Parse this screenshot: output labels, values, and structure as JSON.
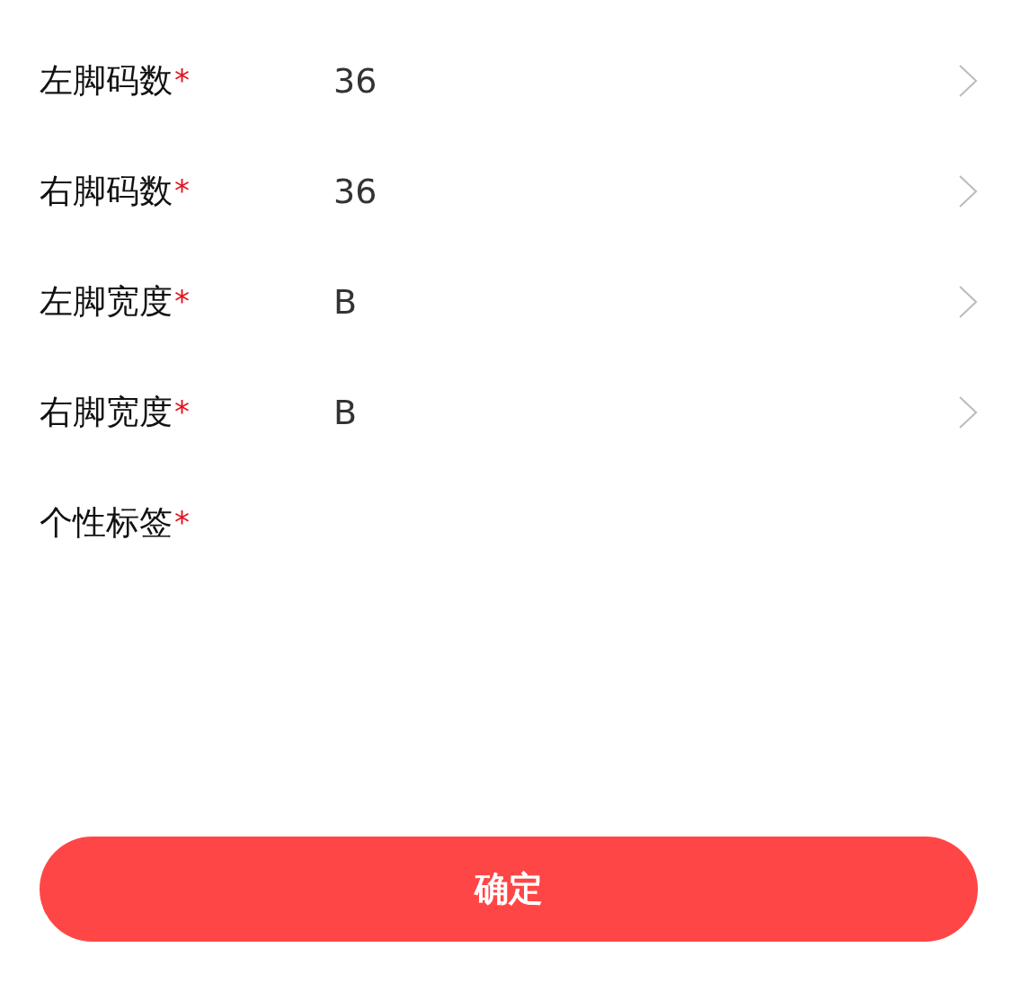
{
  "fields": [
    {
      "kind": "select",
      "label": "左脚码数",
      "required_mark": "*",
      "value": "36"
    },
    {
      "kind": "select",
      "label": "右脚码数",
      "required_mark": "*",
      "value": "36"
    },
    {
      "kind": "select",
      "label": "左脚宽度",
      "required_mark": "*",
      "value": "B"
    },
    {
      "kind": "select",
      "label": "右脚宽度",
      "required_mark": "*",
      "value": "B"
    },
    {
      "kind": "tags",
      "label": "个性标签",
      "required_mark": "*"
    }
  ],
  "confirm_button": "确定"
}
